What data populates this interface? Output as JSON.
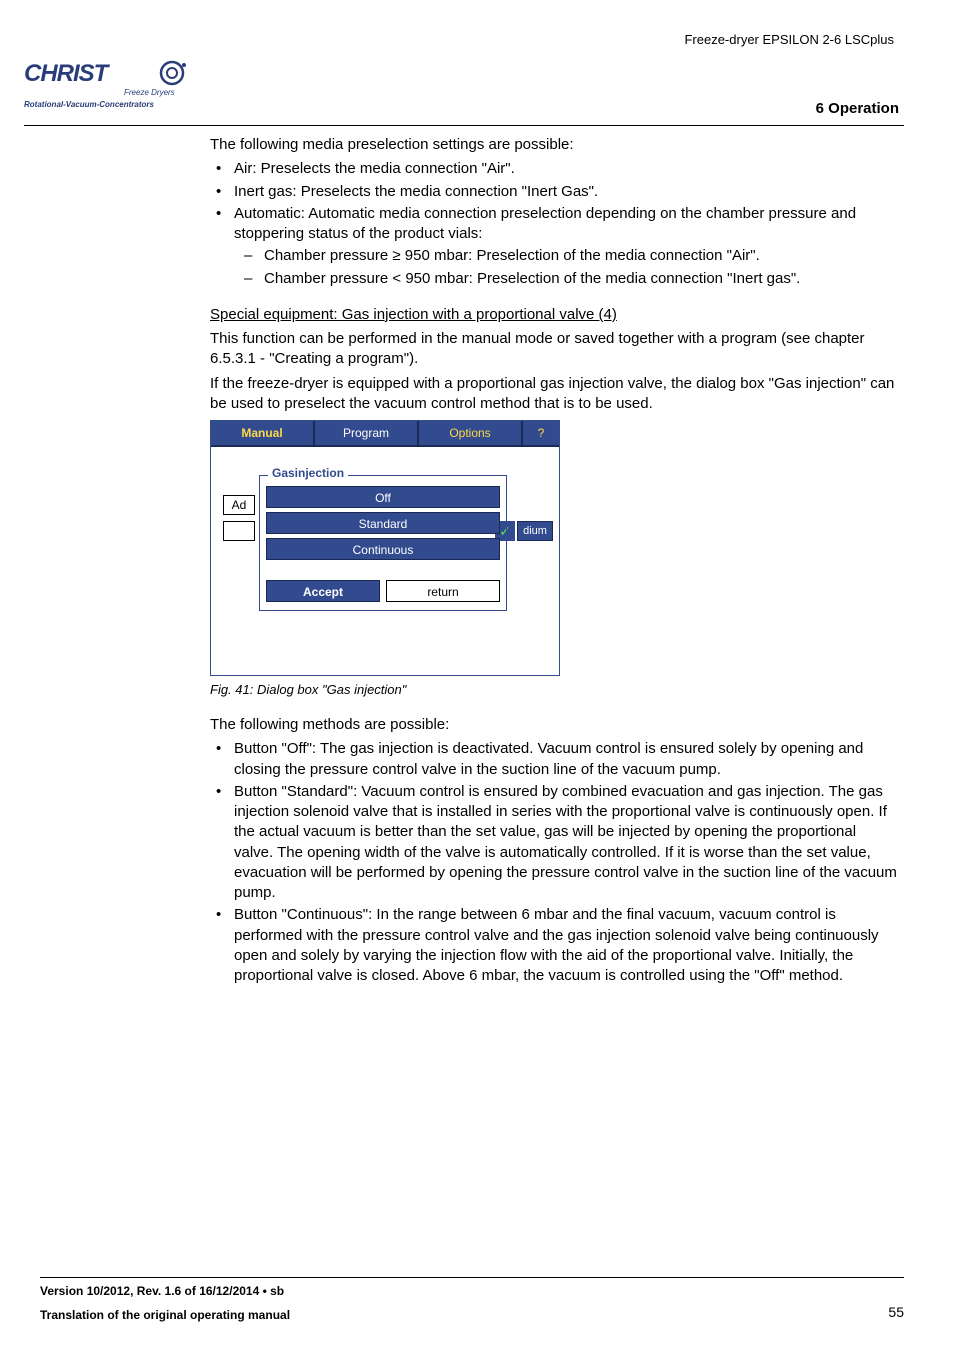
{
  "header": {
    "product": "Freeze-dryer EPSILON 2-6 LSCplus"
  },
  "logo": {
    "brand": "CHRIST",
    "sub1": "Freeze Dryers",
    "sub2": "Rotational-Vacuum-Concentrators"
  },
  "section": {
    "title": "6 Operation"
  },
  "intro": "The following media preselection settings are possible:",
  "bullets_top": {
    "b1": "Air: Preselects the media connection \"Air\".",
    "b2": "Inert gas: Preselects the media connection \"Inert Gas\".",
    "b3": "Automatic: Automatic media connection preselection depending on the chamber pressure and stoppering status of the product vials:",
    "b3_sub1": "Chamber pressure ≥ 950 mbar: Preselection of the media connection \"Air\".",
    "b3_sub2": "Chamber pressure < 950 mbar: Preselection of the media connection \"Inert gas\"."
  },
  "special": {
    "heading": "Special equipment: Gas injection with a proportional valve (4)",
    "p1": "This function can be performed in the manual mode or saved together with a program (see chapter 6.5.3.1 - \"Creating a program\").",
    "p2": "If the freeze-dryer is equipped with a proportional gas injection valve, the dialog box \"Gas injection\" can be used to preselect the vacuum control method that is to be used."
  },
  "dialog": {
    "tabs": {
      "manual": "Manual",
      "program": "Program",
      "options": "Options",
      "q": "?"
    },
    "ad": "Ad",
    "dium": "dium",
    "panel_title": "Gasinjection",
    "opt_off": "Off",
    "opt_standard": "Standard",
    "opt_continuous": "Continuous",
    "accept": "Accept",
    "return": "return"
  },
  "fig_caption": "Fig. 41: Dialog box \"Gas injection\"",
  "methods_intro": "The following methods are possible:",
  "bullets_methods": {
    "m1": "Button \"Off\": The gas injection is deactivated. Vacuum control is ensured solely by opening and closing the pressure control valve in the suction line of the vacuum pump.",
    "m2": "Button \"Standard\": Vacuum control is ensured by combined evacuation and gas injection. The gas injection solenoid valve that is installed in series with the proportional valve is continuously open. If the actual vacuum is better than the set value, gas will be injected by opening the proportional valve. The opening width of the valve is automatically controlled. If it is worse than the set value, evacuation will be performed by opening the pressure control valve in the suction line of the vacuum pump.",
    "m3": "Button \"Continuous\": In the range between 6 mbar and the final vacuum, vacuum control is performed with the pressure control valve and the gas injection solenoid valve being continuously open and solely by varying the injection flow with the aid of the proportional valve. Initially, the proportional valve is closed. Above 6 mbar, the vacuum is controlled using the \"Off\" method."
  },
  "footer": {
    "line1": "Version 10/2012, Rev. 1.6 of 16/12/2014 • sb",
    "line2": "Translation of the original operating manual",
    "page": "55"
  }
}
